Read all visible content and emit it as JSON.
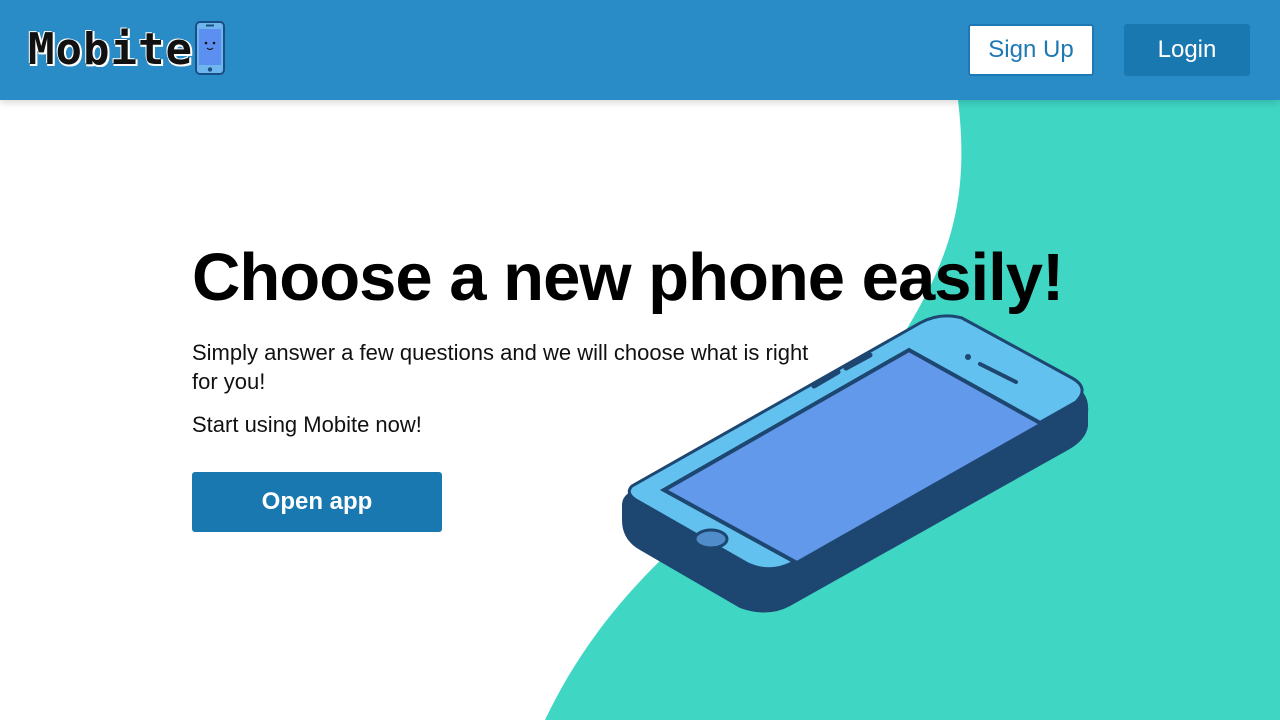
{
  "header": {
    "logo_text": "Mobite",
    "logo_icon": "phone-face-icon",
    "signup_label": "Sign Up",
    "login_label": "Login"
  },
  "hero": {
    "title": "Choose a new phone easily!",
    "subtitle": "Simply answer a few questions and we will choose what is right for you!",
    "cta_text": "Start using Mobite now!",
    "open_app_label": "Open app",
    "illustration_icon": "smartphone-icon"
  },
  "colors": {
    "header_bg": "#2a8cc7",
    "accent_teal": "#40d6c4",
    "button_blue": "#1978b0",
    "phone_body": "#1d4670",
    "phone_frame": "#62c1ee",
    "phone_screen": "#6399ea"
  }
}
